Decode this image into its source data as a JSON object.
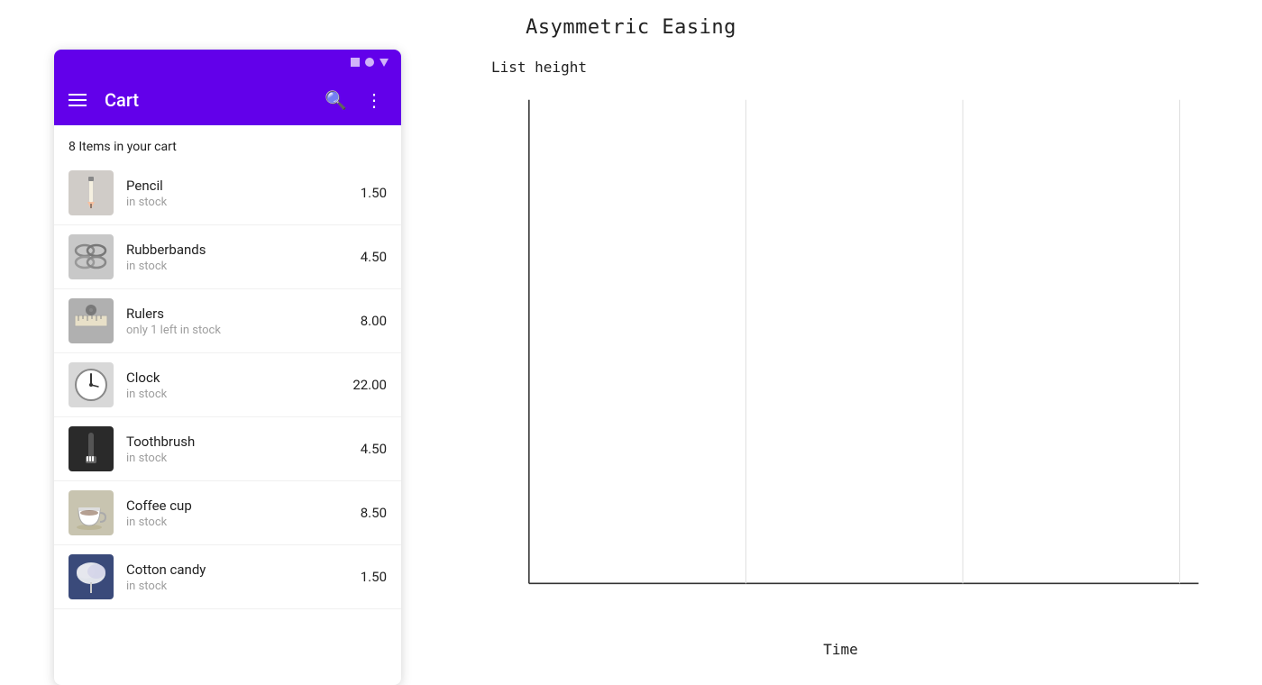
{
  "page": {
    "title": "Asymmetric Easing"
  },
  "toolbar": {
    "title": "Cart",
    "search_label": "🔍",
    "more_label": "⋮"
  },
  "cart": {
    "summary": "8 Items in your cart",
    "items": [
      {
        "name": "Pencil",
        "stock": "in stock",
        "price": "1.50",
        "icon": "pencil"
      },
      {
        "name": "Rubberbands",
        "stock": "in stock",
        "price": "4.50",
        "icon": "rubberbands"
      },
      {
        "name": "Rulers",
        "stock": "only 1 left in stock",
        "price": "8.00",
        "icon": "rulers"
      },
      {
        "name": "Clock",
        "stock": "in stock",
        "price": "22.00",
        "icon": "clock"
      },
      {
        "name": "Toothbrush",
        "stock": "in stock",
        "price": "4.50",
        "icon": "toothbrush"
      },
      {
        "name": "Coffee cup",
        "stock": "in stock",
        "price": "8.50",
        "icon": "coffeecup"
      },
      {
        "name": "Cotton candy",
        "stock": "in stock",
        "price": "1.50",
        "icon": "cottoncandy"
      }
    ]
  },
  "chart": {
    "title": "List height",
    "x_label": "Time"
  }
}
